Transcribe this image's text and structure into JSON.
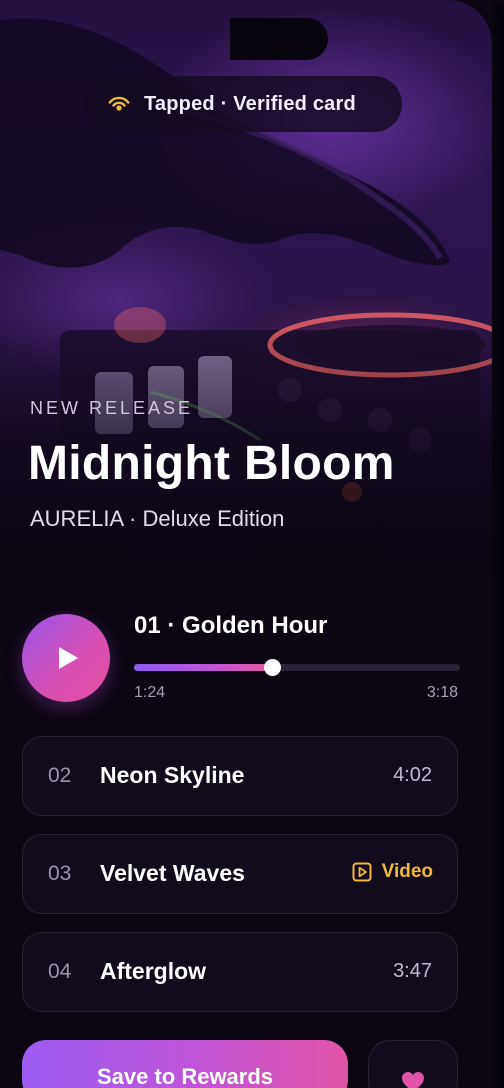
{
  "status_badge": {
    "text": "Tapped · Verified card",
    "icon": "nfc-signal-icon",
    "icon_color": "#f0b93b"
  },
  "release": {
    "eyebrow": "NEW RELEASE",
    "title": "Midnight Bloom",
    "subtitle": "AURELIA · Deluxe Edition"
  },
  "player": {
    "now_playing": "01 · Golden Hour",
    "elapsed": "1:24",
    "duration": "3:18",
    "progress_fraction": 0.424,
    "play_icon": "play-icon"
  },
  "tracks": [
    {
      "number": "02",
      "name": "Neon Skyline",
      "duration": "4:02"
    },
    {
      "number": "03",
      "name": "Velvet Waves",
      "video_label": "Video",
      "video_icon": "video-play-icon"
    },
    {
      "number": "04",
      "name": "Afterglow",
      "duration": "3:47"
    }
  ],
  "actions": {
    "primary_label": "Save to Rewards",
    "favorite_icon": "heart-icon"
  },
  "colors": {
    "background": "#0b0612",
    "accent_purple": "#9b5cf0",
    "accent_pink": "#e054a6",
    "video_gold": "#f0b93b"
  }
}
